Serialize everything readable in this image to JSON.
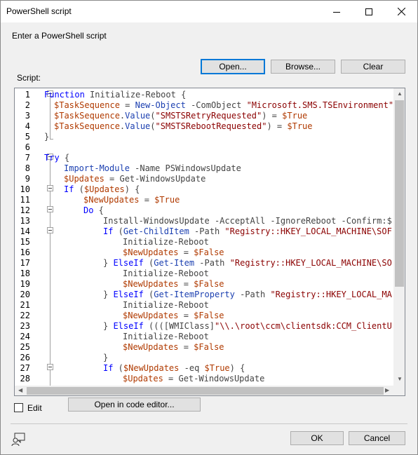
{
  "window": {
    "title": "PowerShell script"
  },
  "prompt": "Enter a PowerShell script",
  "buttons": {
    "open": "Open...",
    "browse": "Browse...",
    "clear": "Clear",
    "open_editor": "Open in code editor...",
    "ok": "OK",
    "cancel": "Cancel"
  },
  "script_label": "Script:",
  "edit_label": "Edit",
  "edit_checked": false,
  "editor": {
    "lines": [
      {
        "n": "1",
        "indent": 0,
        "tokens": [
          [
            "k",
            "Function"
          ],
          [
            "p",
            " Initialize-Reboot {"
          ]
        ]
      },
      {
        "n": "2",
        "indent": 1,
        "tokens": [
          [
            "v",
            "$TaskSequence"
          ],
          [
            "p",
            " = "
          ],
          [
            "c",
            "New-Object"
          ],
          [
            "p",
            " -ComObject "
          ],
          [
            "s",
            "\"Microsoft.SMS.TSEnvironment\""
          ]
        ]
      },
      {
        "n": "3",
        "indent": 1,
        "tokens": [
          [
            "v",
            "$TaskSequence"
          ],
          [
            "p",
            "."
          ],
          [
            "c",
            "Value"
          ],
          [
            "p",
            "("
          ],
          [
            "s",
            "\"SMSTSRetryRequested\""
          ],
          [
            "p",
            ") = "
          ],
          [
            "v",
            "$True"
          ]
        ]
      },
      {
        "n": "4",
        "indent": 1,
        "tokens": [
          [
            "v",
            "$TaskSequence"
          ],
          [
            "p",
            "."
          ],
          [
            "c",
            "Value"
          ],
          [
            "p",
            "("
          ],
          [
            "s",
            "\"SMSTSRebootRequested\""
          ],
          [
            "p",
            ") = "
          ],
          [
            "v",
            "$True"
          ]
        ]
      },
      {
        "n": "5",
        "indent": 0,
        "tokens": [
          [
            "p",
            "}"
          ]
        ]
      },
      {
        "n": "6",
        "indent": 0,
        "tokens": []
      },
      {
        "n": "7",
        "indent": 0,
        "tokens": [
          [
            "k",
            "Try"
          ],
          [
            "p",
            " {"
          ]
        ]
      },
      {
        "n": "8",
        "indent": 2,
        "tokens": [
          [
            "c",
            "Import-Module"
          ],
          [
            "p",
            " -Name PSWindowsUpdate"
          ]
        ]
      },
      {
        "n": "9",
        "indent": 2,
        "tokens": [
          [
            "v",
            "$Updates"
          ],
          [
            "p",
            " = Get-WindowsUpdate"
          ]
        ]
      },
      {
        "n": "10",
        "indent": 2,
        "tokens": [
          [
            "k",
            "If"
          ],
          [
            "p",
            " ("
          ],
          [
            "v",
            "$Updates"
          ],
          [
            "p",
            ") {"
          ]
        ]
      },
      {
        "n": "11",
        "indent": 4,
        "tokens": [
          [
            "v",
            "$NewUpdates"
          ],
          [
            "p",
            " = "
          ],
          [
            "v",
            "$True"
          ]
        ]
      },
      {
        "n": "12",
        "indent": 4,
        "tokens": [
          [
            "k",
            "Do"
          ],
          [
            "p",
            " {"
          ]
        ]
      },
      {
        "n": "13",
        "indent": 6,
        "tokens": [
          [
            "p",
            "Install-WindowsUpdate -AcceptAll -IgnoreReboot -Confirm:$"
          ]
        ]
      },
      {
        "n": "14",
        "indent": 6,
        "tokens": [
          [
            "k",
            "If"
          ],
          [
            "p",
            " ("
          ],
          [
            "c",
            "Get-ChildItem"
          ],
          [
            "p",
            " -Path "
          ],
          [
            "s",
            "\"Registry::HKEY_LOCAL_MACHINE\\SOF"
          ]
        ]
      },
      {
        "n": "15",
        "indent": 8,
        "tokens": [
          [
            "p",
            "Initialize-Reboot"
          ]
        ]
      },
      {
        "n": "16",
        "indent": 8,
        "tokens": [
          [
            "v",
            "$NewUpdates"
          ],
          [
            "p",
            " = "
          ],
          [
            "v",
            "$False"
          ]
        ]
      },
      {
        "n": "17",
        "indent": 6,
        "tokens": [
          [
            "p",
            "} "
          ],
          [
            "k",
            "ElseIf"
          ],
          [
            "p",
            " ("
          ],
          [
            "c",
            "Get-Item"
          ],
          [
            "p",
            " -Path "
          ],
          [
            "s",
            "\"Registry::HKEY_LOCAL_MACHINE\\SO"
          ]
        ]
      },
      {
        "n": "18",
        "indent": 8,
        "tokens": [
          [
            "p",
            "Initialize-Reboot"
          ]
        ]
      },
      {
        "n": "19",
        "indent": 8,
        "tokens": [
          [
            "v",
            "$NewUpdates"
          ],
          [
            "p",
            " = "
          ],
          [
            "v",
            "$False"
          ]
        ]
      },
      {
        "n": "20",
        "indent": 6,
        "tokens": [
          [
            "p",
            "} "
          ],
          [
            "k",
            "ElseIf"
          ],
          [
            "p",
            " ("
          ],
          [
            "c",
            "Get-ItemProperty"
          ],
          [
            "p",
            " -Path "
          ],
          [
            "s",
            "\"Registry::HKEY_LOCAL_MA"
          ]
        ]
      },
      {
        "n": "21",
        "indent": 8,
        "tokens": [
          [
            "p",
            "Initialize-Reboot"
          ]
        ]
      },
      {
        "n": "22",
        "indent": 8,
        "tokens": [
          [
            "v",
            "$NewUpdates"
          ],
          [
            "p",
            " = "
          ],
          [
            "v",
            "$False"
          ]
        ]
      },
      {
        "n": "23",
        "indent": 6,
        "tokens": [
          [
            "p",
            "} "
          ],
          [
            "k",
            "ElseIf"
          ],
          [
            "p",
            " ((([WMIClass]"
          ],
          [
            "s",
            "\"\\\\.\\root\\ccm\\clientsdk:CCM_ClientU"
          ]
        ]
      },
      {
        "n": "24",
        "indent": 8,
        "tokens": [
          [
            "p",
            "Initialize-Reboot"
          ]
        ]
      },
      {
        "n": "25",
        "indent": 8,
        "tokens": [
          [
            "v",
            "$NewUpdates"
          ],
          [
            "p",
            " = "
          ],
          [
            "v",
            "$False"
          ]
        ]
      },
      {
        "n": "26",
        "indent": 6,
        "tokens": [
          [
            "p",
            "}"
          ]
        ]
      },
      {
        "n": "27",
        "indent": 6,
        "tokens": [
          [
            "k",
            "If"
          ],
          [
            "p",
            " ("
          ],
          [
            "v",
            "$NewUpdates"
          ],
          [
            "p",
            " -eq "
          ],
          [
            "v",
            "$True"
          ],
          [
            "p",
            ") {"
          ]
        ]
      },
      {
        "n": "28",
        "indent": 8,
        "tokens": [
          [
            "v",
            "$Updates"
          ],
          [
            "p",
            " = Get-WindowsUpdate"
          ]
        ]
      }
    ]
  }
}
